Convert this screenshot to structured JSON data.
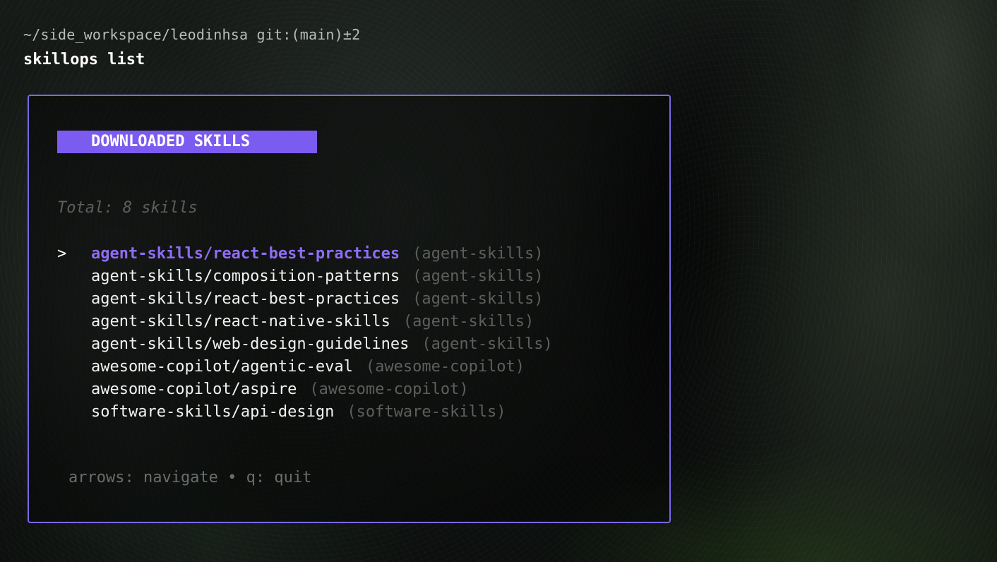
{
  "terminal": {
    "prompt_path": "~/side_workspace/leodinhsa git:(main)±2",
    "command": "skillops list"
  },
  "panel": {
    "title": "DOWNLOADED SKILLS",
    "total_text": "Total: 8 skills",
    "cursor_glyph": ">",
    "selected_index": 0,
    "skills": [
      {
        "name": "agent-skills/react-best-practices",
        "source": "(agent-skills)"
      },
      {
        "name": "agent-skills/composition-patterns",
        "source": "(agent-skills)"
      },
      {
        "name": "agent-skills/react-best-practices",
        "source": "(agent-skills)"
      },
      {
        "name": "agent-skills/react-native-skills",
        "source": "(agent-skills)"
      },
      {
        "name": "agent-skills/web-design-guidelines",
        "source": "(agent-skills)"
      },
      {
        "name": "awesome-copilot/agentic-eval",
        "source": "(awesome-copilot)"
      },
      {
        "name": "awesome-copilot/aspire",
        "source": "(awesome-copilot)"
      },
      {
        "name": "software-skills/api-design",
        "source": "(software-skills)"
      }
    ],
    "hint": "arrows: navigate • q: quit"
  },
  "colors": {
    "accent": "#7c5cf0",
    "border": "#7b68e6",
    "selected_text": "#8f6cf5",
    "muted_text": "#5c605c"
  }
}
